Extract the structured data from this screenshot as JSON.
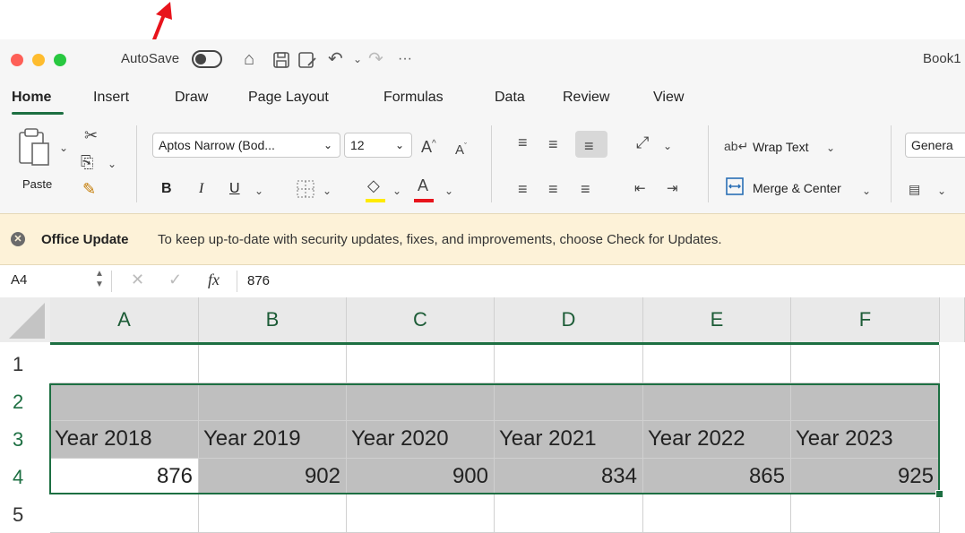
{
  "titlebar": {
    "autosave_label": "AutoSave",
    "window_title": "Book1"
  },
  "tabs": [
    "Home",
    "Insert",
    "Draw",
    "Page Layout",
    "Formulas",
    "Data",
    "Review",
    "View"
  ],
  "ribbon": {
    "paste_label": "Paste",
    "font_name": "Aptos Narrow (Bod...",
    "font_size": "12",
    "bold": "B",
    "italic": "I",
    "underline": "U",
    "wrap_text": "Wrap Text",
    "merge_center": "Merge & Center",
    "number_format": "Genera"
  },
  "banner": {
    "title": "Office Update",
    "message": "To keep up-to-date with security updates, fixes, and improvements, choose Check for Updates."
  },
  "formula_bar": {
    "name_box": "A4",
    "fx": "fx",
    "value": "876"
  },
  "sheet": {
    "columns": [
      "A",
      "B",
      "C",
      "D",
      "E",
      "F"
    ],
    "rows": [
      "1",
      "2",
      "3",
      "4",
      "5"
    ],
    "row3": [
      "Year 2018",
      "Year 2019",
      "Year 2020",
      "Year 2021",
      "Year 2022",
      "Year 2023"
    ],
    "row4": [
      "876",
      "902",
      "900",
      "834",
      "865",
      "925"
    ]
  },
  "colors": {
    "accent": "#1d6f42",
    "selection_fill": "#bfbfbf",
    "banner_bg": "#fdf2d8",
    "arrow": "#e8141c"
  },
  "icons": [
    "home-icon",
    "save-icon",
    "save-as-icon",
    "undo-icon",
    "redo-icon",
    "more-icon",
    "cut-icon",
    "copy-icon",
    "format-painter-icon",
    "grow-font-icon",
    "shrink-font-icon",
    "borders-icon",
    "fill-color-icon",
    "font-color-icon",
    "align-icons",
    "orientation-icon",
    "indent-icons",
    "close-circle-icon"
  ]
}
